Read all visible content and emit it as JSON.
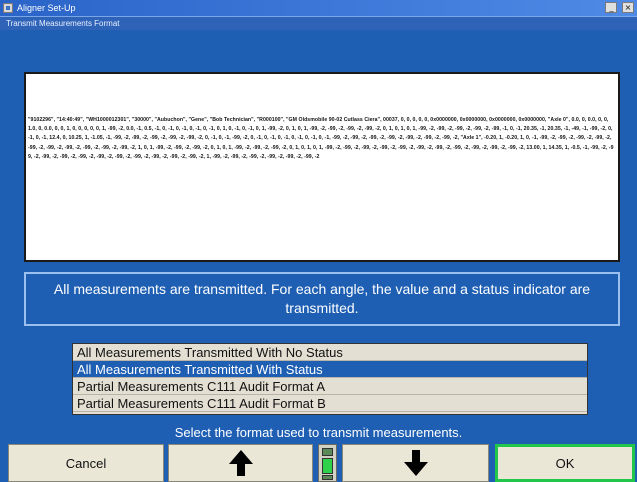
{
  "window": {
    "title": "Aligner Set-Up",
    "minimize_glyph": "_",
    "close_glyph": "×"
  },
  "panel": {
    "title": "Transmit Measurements Format"
  },
  "sample_output": "\"9102296\", \"14:40:49\", \"WH1000012301\", \"30000\", \"Aubuchon\", \"Gene\", \"Bob Technician\", \"R000100\", \"GM Oldsmobile 90-02 Cutlass Ciera\", 00037, 0, 0, 0, 0, 0, 0x0000000, 0x0000000, 0x0000000, 0x0000000, \"Axle 0\", 0.0, 0, 0.0, 0, 0, 1.0, 0, 0.0, 0, 0, 1, 0, 0, 0, 0, 0, 1, -99, -2, 0.0, -1, 0.5, -1, 0, -1, 0, -1, 0, -1, 0, -1, 0, 1, 0, -1, 0, -1, 0, 1, -99, -2, 0, 1, 0, 1, -99, -2, -99, -2, -99, -2, -99, -2, 0, 1, 0, 1, 0, 1, -99, -2, -99, -2, -99, -2, -99, -2, -99, -1, 0, -1, 20.35, -1, 20.35, -1, -49, -1, -99, -2, 0, -1, 0, -1, 12.4, 0, 10.25, 1, -1.05, -1, -99, -2, -99, -2, -99, -2, -99, -2, -99, -2, 0, -1, 0, -1, -99, -2, 0, -1, 0, -1, 0, -1, 0, -1, 0, -1, 0, -1, -99, -2, -99, -2, -99, -2, -99, -2, -99, -2, -99, -2, -99, -2, \"Axle 1\", -0.20, 1, -0.20, 1, 0, -1, -99, -2, -99, -2, -99, -2, -99, -2, -99, -2, -99, -2, -99, -2, -99, -2, -99, -2, -99, -2, 1, 0, 1, -99, -2, -99, -2, -99, -2, 0, 1, 0, 1, -99, -2, -99, -2, -99, -2, 0, 1, 0, 1, 0, 1, -99, -2, -99, -2, -99, -2, -99, -2, -99, -2, -99, -2, -99, -2, -99, -2, -99, -2, -99, -2, -99, -2, 13.00, 1, 14.35, 1, -0.5, -1, -99, -2, -99, -2, -99, -2, -99, -2, -99, -2, -99, -2, -99, -2, -99, -2, -99, -2, -99, -2, -99, -2, 1, -99, -2, -99, -2, -99, -2, -99, -2, -99, -2, -99, -2",
  "description": "All measurements are transmitted.  For each angle, the value and a status indicator are transmitted.",
  "options": [
    "All Measurements Transmitted With No Status",
    "All Measurements Transmitted With Status",
    "Partial Measurements C111 Audit Format A",
    "Partial Measurements C111 Audit Format B"
  ],
  "selected_option_index": 1,
  "prompt": "Select the format used to transmit measurements.",
  "buttons": {
    "cancel": "Cancel",
    "up_icon": "up-arrow-icon",
    "down_icon": "down-arrow-icon",
    "ok": "OK"
  },
  "page_indicator": {
    "icon": "scroll-position-indicator"
  },
  "colors": {
    "background": "#1e5fb4",
    "selection": "#1e5fb4",
    "ok_border": "#22c64a",
    "button_face": "#eae7d6"
  }
}
